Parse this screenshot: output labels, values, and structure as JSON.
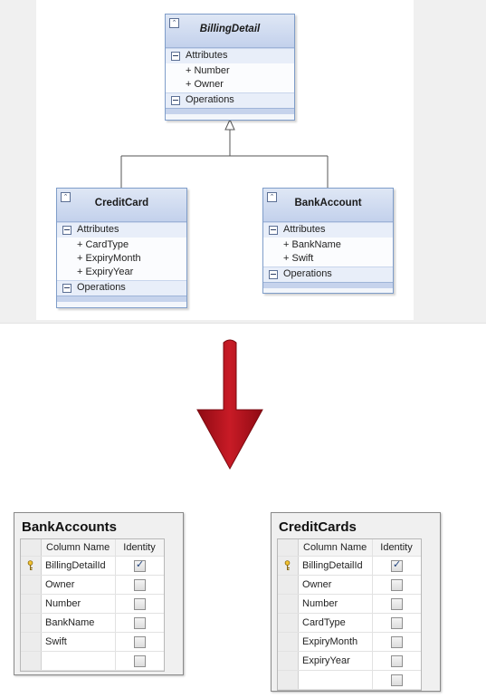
{
  "uml": {
    "billing_detail": {
      "name": "BillingDetail",
      "attributes_label": "Attributes",
      "attributes": [
        "+ Number",
        "+ Owner"
      ],
      "operations_label": "Operations"
    },
    "credit_card": {
      "name": "CreditCard",
      "attributes_label": "Attributes",
      "attributes": [
        "+ CardType",
        "+ ExpiryMonth",
        "+ ExpiryYear"
      ],
      "operations_label": "Operations"
    },
    "bank_account": {
      "name": "BankAccount",
      "attributes_label": "Attributes",
      "attributes": [
        "+ BankName",
        "+ Swift"
      ],
      "operations_label": "Operations"
    }
  },
  "tables": {
    "bank_accounts": {
      "name": "BankAccounts",
      "col_name_header": "Column Name",
      "identity_header": "Identity",
      "rows": [
        {
          "name": "BillingDetailId",
          "identity": true,
          "key": true
        },
        {
          "name": "Owner",
          "identity": false,
          "key": false
        },
        {
          "name": "Number",
          "identity": false,
          "key": false
        },
        {
          "name": "BankName",
          "identity": false,
          "key": false
        },
        {
          "name": "Swift",
          "identity": false,
          "key": false
        },
        {
          "name": "",
          "identity": false,
          "key": false
        }
      ]
    },
    "credit_cards": {
      "name": "CreditCards",
      "col_name_header": "Column Name",
      "identity_header": "Identity",
      "rows": [
        {
          "name": "BillingDetailId",
          "identity": true,
          "key": true
        },
        {
          "name": "Owner",
          "identity": false,
          "key": false
        },
        {
          "name": "Number",
          "identity": false,
          "key": false
        },
        {
          "name": "CardType",
          "identity": false,
          "key": false
        },
        {
          "name": "ExpiryMonth",
          "identity": false,
          "key": false
        },
        {
          "name": "ExpiryYear",
          "identity": false,
          "key": false
        },
        {
          "name": "",
          "identity": false,
          "key": false
        }
      ]
    }
  },
  "colors": {
    "arrow": "#b3121d",
    "class_header": "#c3d1ec",
    "class_border": "#7f9dc9"
  }
}
